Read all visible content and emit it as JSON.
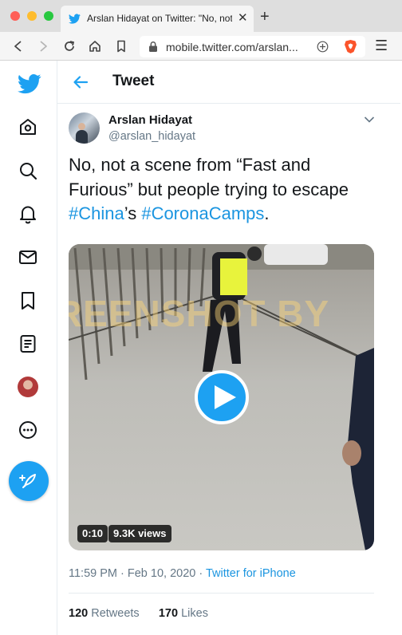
{
  "browser": {
    "tab_title": "Arslan Hidayat on Twitter: \"No, not",
    "url": "mobile.twitter.com/arslan..."
  },
  "header": {
    "title": "Tweet"
  },
  "tweet": {
    "author_name": "Arslan Hidayat",
    "author_handle": "@arslan_hidayat",
    "text_line1": "No, not a scene from “Fast and",
    "text_line2": "Furious” but people trying to escape",
    "hashtag_china": "#China",
    "possessive": "’s ",
    "hashtag_coronacamps": "#CoronaCamps",
    "period": ".",
    "video_duration": "0:10",
    "video_views": "9.3K views",
    "watermark": "SCREENSHOT BY",
    "time": "11:59 PM",
    "separator": " · ",
    "date": "Feb 10, 2020",
    "source": "Twitter for iPhone",
    "retweet_count": "120",
    "retweet_label": "Retweets",
    "like_count": "170",
    "like_label": "Likes"
  },
  "nav": {
    "items": [
      "home-icon",
      "explore-icon",
      "notifications-icon",
      "messages-icon",
      "bookmarks-icon",
      "lists-icon",
      "profile-avatar",
      "more-icon"
    ]
  },
  "colors": {
    "accent": "#1da1f2",
    "link": "#1b95e0",
    "text": "#14171a",
    "secondary": "#657786"
  }
}
